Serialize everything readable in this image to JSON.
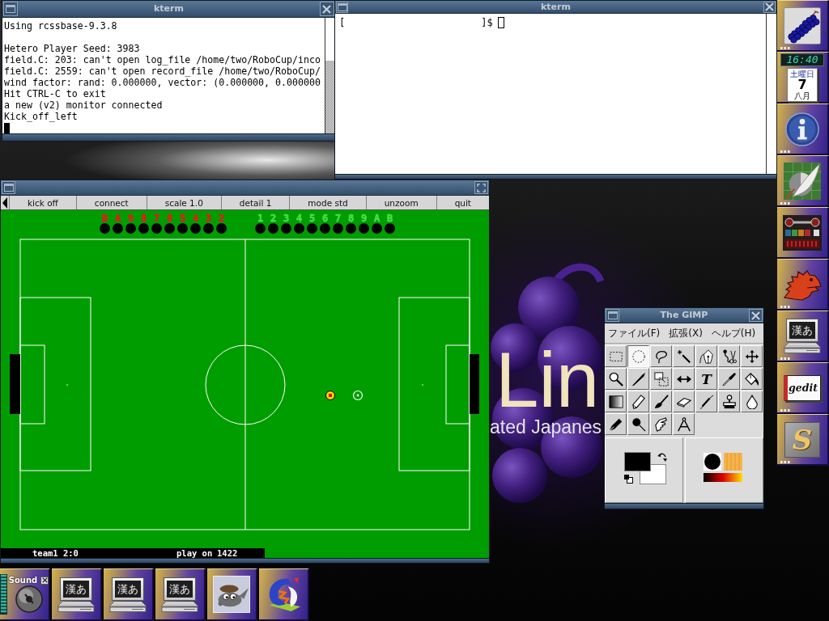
{
  "wallpaper": {
    "logo_text": "Lin",
    "tagline": "ated Japanes"
  },
  "terminals": [
    {
      "title": "kterm",
      "blocks": [
        [
          "Using rcssbase-9.3.8"
        ],
        [
          "Hetero Player Seed: 3983",
          "field.C: 203: can't open log_file /home/two/RoboCup/inco",
          "field.C: 2559: can't open record_file /home/two/RoboCup/",
          "wind factor: rand: 0.000000, vector: (0.000000, 0.000000",
          "Hit CTRL-C to exit",
          "a new (v2) monitor connected",
          "Kick_off_left"
        ]
      ],
      "hollow_cursor": false,
      "has_scrollback": true
    },
    {
      "title": "kterm",
      "prompt": {
        "open": "[",
        "close": "]$"
      },
      "hollow_cursor": true,
      "has_scrollback": false
    }
  ],
  "soccer_monitor": {
    "buttons": [
      "kick off",
      "connect",
      "scale 1.0",
      "detail 1",
      "mode std",
      "unzoom",
      "quit"
    ],
    "bench": [
      {
        "color": "#e01c1c",
        "players": [
          "B",
          "A",
          "9",
          "8",
          "7",
          "6",
          "5",
          "4",
          "3",
          "2"
        ]
      },
      {
        "color": "#44e044",
        "players": [
          "1",
          "2",
          "3",
          "4",
          "5",
          "6",
          "7",
          "8",
          "9",
          "A",
          "B"
        ]
      }
    ],
    "status": {
      "score": "team1 2:0",
      "play_mode": "play_on",
      "time": "1422"
    }
  },
  "gimp": {
    "title": "The GIMP",
    "menus": [
      "ファイル(F)",
      "拡張(X)",
      "ヘルプ(H)"
    ],
    "tools": [
      {
        "selected": false
      },
      {
        "selected": true
      },
      {
        "selected": false
      },
      {
        "selected": false
      },
      {
        "selected": false
      },
      {
        "selected": false
      },
      {
        "selected": false
      },
      {
        "selected": false
      },
      {
        "selected": false
      },
      {
        "selected": false
      },
      {
        "selected": false
      },
      {
        "selected": false,
        "label": "T"
      },
      {
        "selected": false
      },
      {
        "selected": false
      },
      {
        "selected": false
      },
      {
        "selected": false
      },
      {
        "selected": false
      },
      {
        "selected": false
      },
      {
        "selected": false
      },
      {
        "selected": false
      },
      {
        "selected": false
      },
      {
        "selected": false
      },
      {
        "selected": false
      },
      {
        "selected": false
      },
      {
        "selected": false
      }
    ]
  },
  "dock": [
    {
      "kind": "grapes",
      "drawer": true
    },
    {
      "kind": "clock",
      "drawer": false,
      "time": "16:40",
      "weekday": "土曜日",
      "day": "7",
      "month": "八月"
    },
    {
      "kind": "info",
      "drawer": true
    },
    {
      "kind": "quill",
      "drawer": true
    },
    {
      "kind": "mixer",
      "drawer": false
    },
    {
      "kind": "dinosaur",
      "drawer": true
    },
    {
      "kind": "terminal",
      "drawer": true,
      "label": "漢あ"
    },
    {
      "kind": "editor",
      "drawer": true,
      "label": "gedit"
    },
    {
      "kind": "emblem",
      "drawer": true,
      "label": "S"
    }
  ],
  "taskbar": [
    {
      "kind": "sound",
      "label": "Sound"
    },
    {
      "kind": "terminal",
      "label": "漢あ"
    },
    {
      "kind": "terminal",
      "label": "漢あ"
    },
    {
      "kind": "terminal",
      "label": "漢あ"
    },
    {
      "kind": "creature"
    },
    {
      "kind": "swirl"
    }
  ]
}
